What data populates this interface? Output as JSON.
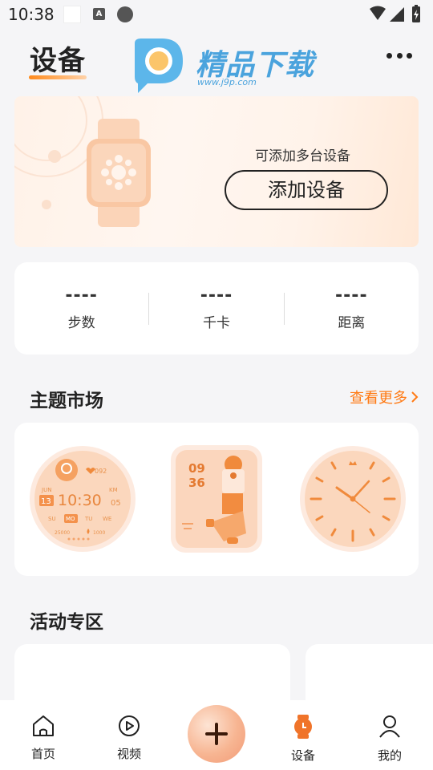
{
  "status_bar": {
    "time": "10:38",
    "a_icon": "A"
  },
  "header": {
    "title": "设备",
    "more_icon": "more-dots-icon"
  },
  "watermark": {
    "brand": "精品下载",
    "url": "www.j9p.com"
  },
  "banner": {
    "caption": "可添加多台设备",
    "add_device_label": "添加设备"
  },
  "stats": [
    {
      "value": "----",
      "label": "步数"
    },
    {
      "value": "----",
      "label": "千卡"
    },
    {
      "value": "----",
      "label": "距离"
    }
  ],
  "themes": {
    "title": "主题市场",
    "view_more": "查看更多",
    "face1": {
      "heart": "092",
      "month": "JUN",
      "km": "KM",
      "day": "13",
      "time": "10:30",
      "km_val": "05",
      "days": [
        "SU",
        "MO",
        "TU",
        "WE"
      ],
      "steps": "25000",
      "cal": "1000"
    },
    "face2": {
      "hour": "09",
      "minute": "36"
    }
  },
  "activities": {
    "title": "活动专区"
  },
  "nav": {
    "home": "首页",
    "video": "视频",
    "device": "设备",
    "mine": "我的"
  },
  "colors": {
    "accent": "#ff7a14",
    "background": "#f5f5f7"
  }
}
